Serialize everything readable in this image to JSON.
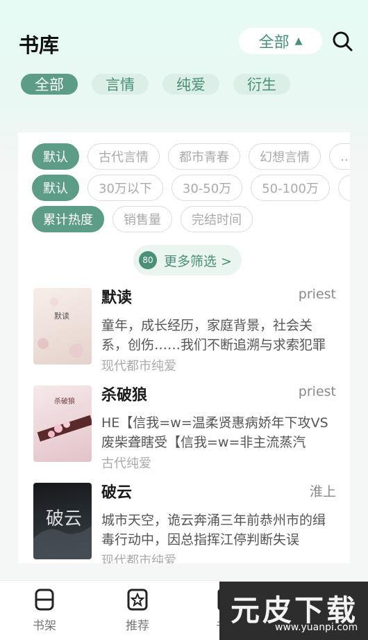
{
  "header": {
    "title": "书库",
    "scope_label": "全部",
    "scope_arrow": "▲"
  },
  "category_tabs": [
    {
      "label": "全部",
      "active": true
    },
    {
      "label": "言情",
      "active": false
    },
    {
      "label": "纯爱",
      "active": false
    },
    {
      "label": "衍生",
      "active": false
    }
  ],
  "filters": {
    "genre": [
      "默认",
      "古代言情",
      "都市青春",
      "幻想言情",
      "…"
    ],
    "word_count": [
      "默认",
      "30万以下",
      "30-50万",
      "50-100万",
      "…"
    ],
    "sort": [
      "累计热度",
      "销售量",
      "完结时间"
    ],
    "more_label": "更多筛选 >",
    "more_icon_text": "80"
  },
  "books": [
    {
      "title": "默读",
      "author": "priest",
      "description": "童年，成长经历，家庭背景，社会关系，创伤……我们不断追溯与求索犯罪",
      "tag": "现代都市纯爱",
      "cover_text": "默读",
      "cover_colors": [
        "#f6ece6",
        "#e7d5cf"
      ]
    },
    {
      "title": "杀破狼",
      "author": "priest",
      "description": "HE【信我=w=温柔贤惠病娇年下攻VS废柴聋瞎受【信我=w=非主流蒸汽",
      "tag": "古代纯爱",
      "cover_text": "杀破狼",
      "cover_colors": [
        "#f4e7e7",
        "#e6c9cf"
      ]
    },
    {
      "title": "破云",
      "author": "淮上",
      "description": "城市天空，诡云奔涌三年前恭州市的缉毒行动中，因总指挥江停判断失误",
      "tag": "现代都市纯爱",
      "cover_text": "破云",
      "cover_colors": [
        "#1b1f22",
        "#3a4046"
      ]
    }
  ],
  "tabbar": [
    {
      "label": "书架",
      "icon": "bookshelf-icon"
    },
    {
      "label": "推荐",
      "icon": "recommend-icon"
    },
    {
      "label": "书库",
      "icon": "library-icon"
    }
  ],
  "watermark": {
    "main": "元皮下载",
    "sub": "www.yuanpi.com"
  },
  "colors": {
    "accent": "#5d9c86",
    "accent_light": "#dcefe7",
    "header_gradient_top": "#e6fbf4"
  }
}
